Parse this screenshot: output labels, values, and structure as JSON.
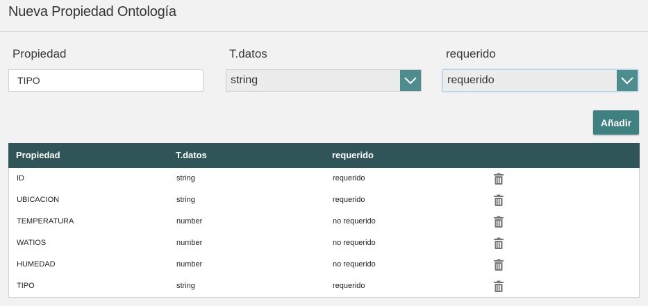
{
  "header": {
    "title": "Nueva Propiedad Ontología"
  },
  "form": {
    "propiedad_label": "Propiedad",
    "propiedad_value": "TIPO",
    "tdatos_label": "T.datos",
    "tdatos_value": "string",
    "requerido_label": "requerido",
    "requerido_value": "requerido",
    "add_label": "Añadir"
  },
  "table": {
    "columns": [
      "Propiedad",
      "T.datos",
      "requerido"
    ],
    "rows": [
      {
        "propiedad": "ID",
        "tipo": "string",
        "requerido": "requerido"
      },
      {
        "propiedad": "UBICACION",
        "tipo": "string",
        "requerido": "requerido"
      },
      {
        "propiedad": "TEMPERATURA",
        "tipo": "number",
        "requerido": "no requerido"
      },
      {
        "propiedad": "WATIOS",
        "tipo": "number",
        "requerido": "no requerido"
      },
      {
        "propiedad": "HUMEDAD",
        "tipo": "number",
        "requerido": "no requerido"
      },
      {
        "propiedad": "TIPO",
        "tipo": "string",
        "requerido": "requerido"
      }
    ]
  },
  "colors": {
    "accent": "#4e8d8d",
    "table_header": "#2f5558",
    "button": "#3f8080"
  },
  "icons": {
    "dropdown": "chevron-down-icon",
    "delete": "trash-icon"
  }
}
